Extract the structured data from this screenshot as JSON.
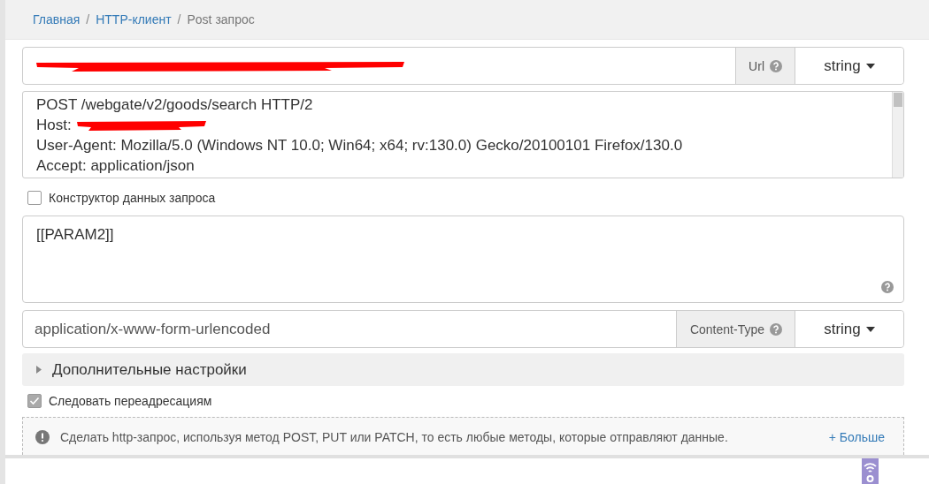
{
  "breadcrumb": [
    {
      "kind": "link",
      "label": "Главная"
    },
    {
      "kind": "separator",
      "label": "/"
    },
    {
      "kind": "link",
      "label": "HTTP-клиент"
    },
    {
      "kind": "separator",
      "label": "/"
    },
    {
      "kind": "current",
      "label": "Post запрос"
    }
  ],
  "url_field": {
    "redacted": true,
    "addon": "Url",
    "type_dropdown": "string"
  },
  "request_headers": {
    "lines": [
      {
        "text": "POST /webgate/v2/goods/search HTTP/2",
        "redacted": false
      },
      {
        "text": "Host:",
        "redacted": true
      },
      {
        "text": "User-Agent: Mozilla/5.0 (Windows NT 10.0; Win64; x64; rv:130.0) Gecko/20100101 Firefox/130.0",
        "redacted": false
      },
      {
        "text": "Accept: application/json",
        "redacted": false
      }
    ]
  },
  "data_builder": {
    "label": "Конструктор данных запроса",
    "checked": false
  },
  "body": {
    "value": "[[PARAM2]]"
  },
  "content_type_field": {
    "value": "application/x-www-form-urlencoded",
    "addon": "Content-Type",
    "type_dropdown": "string"
  },
  "advanced_settings": {
    "label": "Дополнительные настройки",
    "expanded": false
  },
  "follow_redirects": {
    "label": "Следовать переадресациям",
    "checked": true
  },
  "info": {
    "text": "Сделать http-запрос, используя метод POST, PUT или PATCH, то есть любые методы, которые отправляют данные.",
    "more_link": "+ Больше"
  }
}
